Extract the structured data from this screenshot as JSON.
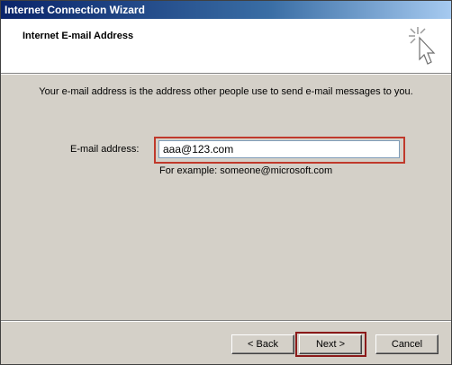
{
  "window": {
    "title": "Internet Connection Wizard"
  },
  "header": {
    "page_title": "Internet E-mail Address",
    "icon": "wizard-wand-icon"
  },
  "main": {
    "intro": "Your e-mail address is the address other people use to send e-mail messages to you.",
    "email_label": "E-mail address:",
    "email_value": "aaa@123.com",
    "example": "For example: someone@microsoft.com"
  },
  "buttons": {
    "back": "< Back",
    "next": "Next >",
    "cancel": "Cancel"
  },
  "colors": {
    "highlight": "#c0392b",
    "titlebar": "#0a246a"
  }
}
